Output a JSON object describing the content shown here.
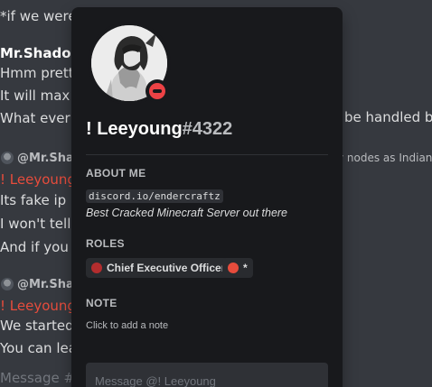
{
  "chat": {
    "line_top": "*if we were",
    "author_1": "Mr.Shadow",
    "msg_1": "Hmm pretty",
    "msg_2": "It will max to",
    "msg_3": "What ever h",
    "msg_3_right": "be handled by",
    "reply_1_author": "@Mr.Shad",
    "reply_1_right": "y nodes as Indian",
    "author_2": "! Leeyoung",
    "msg_4": "Its fake ip",
    "msg_5": "I won't tell i",
    "msg_6": "And if you th",
    "reply_2_author": "@Mr.Shad",
    "author_3": "! Leeyoung",
    "msg_7": "We started",
    "msg_8": "You can leav",
    "composer_placeholder": "Message #"
  },
  "profile": {
    "username": "! Leeyoung",
    "discriminator": "#4322",
    "status": "dnd",
    "status_color": "#ed4245",
    "about_title": "ABOUT ME",
    "about_code": "discord.io/endercraftz",
    "about_text": "Best Cracked Minecraft Server out there",
    "roles_title": "ROLES",
    "roles": [
      {
        "name": "Chief Executive Officer",
        "color": "#b32d2e"
      },
      {
        "name": "*",
        "color": "#e74c3c"
      }
    ],
    "note_title": "NOTE",
    "note_placeholder": "Click to add a note",
    "message_placeholder": "Message @! Leeyoung"
  },
  "colors": {
    "background": "#36393f",
    "popout": "#18191c",
    "username_red": "#e74c3c"
  }
}
